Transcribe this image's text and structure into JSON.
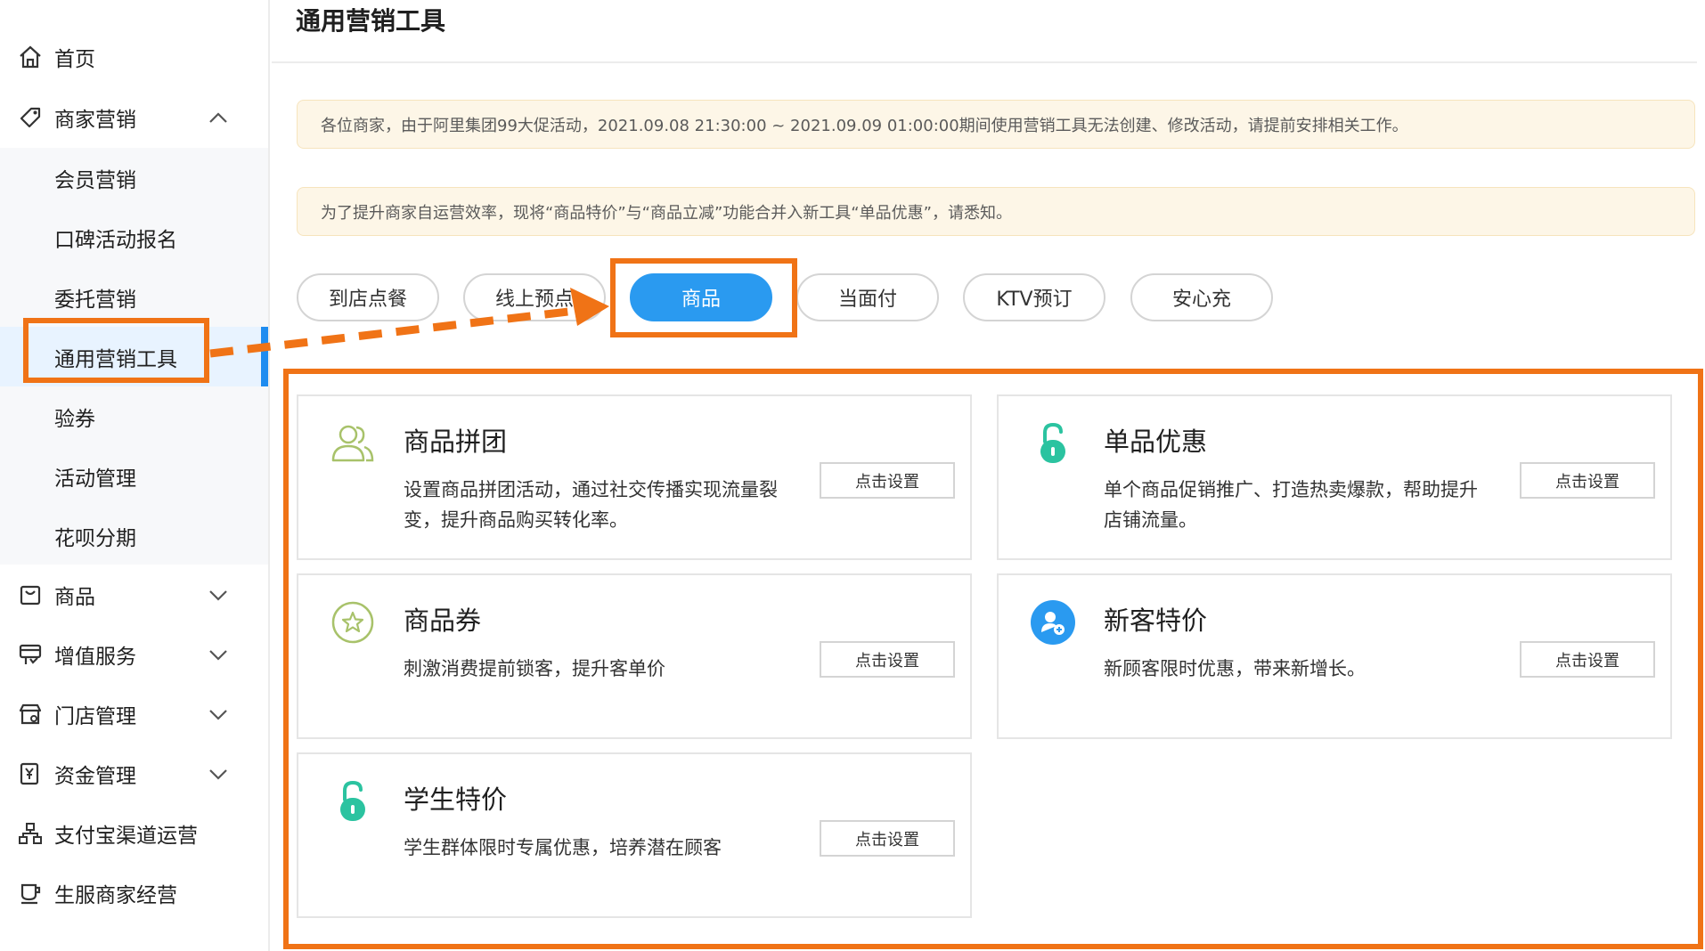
{
  "sidebar": {
    "items": [
      {
        "label": "首页",
        "icon": "home-icon"
      },
      {
        "label": "商家营销",
        "icon": "tag-icon",
        "expanded": true,
        "children": [
          "会员营销",
          "口碑活动报名",
          "委托营销",
          "通用营销工具",
          "验券",
          "活动管理",
          "花呗分期"
        ]
      },
      {
        "label": "商品",
        "icon": "bag-icon"
      },
      {
        "label": "增值服务",
        "icon": "value-service-icon"
      },
      {
        "label": "门店管理",
        "icon": "store-icon"
      },
      {
        "label": "资金管理",
        "icon": "funds-icon"
      },
      {
        "label": "支付宝渠道运营",
        "icon": "org-chart-icon"
      },
      {
        "label": "生服商家经营",
        "icon": "cup-icon"
      }
    ],
    "active_child": "通用营销工具"
  },
  "page": {
    "title": "通用营销工具",
    "notices": [
      "各位商家，由于阿里集团99大促活动，2021.09.08 21:30:00 ~ 2021.09.09 01:00:00期间使用营销工具无法创建、修改活动，请提前安排相关工作。",
      "为了提升商家自运营效率，现将“商品特价”与“商品立减”功能合并入新工具“单品优惠”，请悉知。"
    ]
  },
  "tabs": [
    {
      "label": "到店点餐",
      "active": false
    },
    {
      "label": "线上预点",
      "active": false
    },
    {
      "label": "商品",
      "active": true
    },
    {
      "label": "当面付",
      "active": false
    },
    {
      "label": "KTV预订",
      "active": false
    },
    {
      "label": "安心充",
      "active": false
    }
  ],
  "cards": [
    {
      "title": "商品拼团",
      "desc": "设置商品拼团活动，通过社交传播实现流量裂变，提升商品购买转化率。",
      "button": "点击设置",
      "icon": "group-users-icon"
    },
    {
      "title": "单品优惠",
      "desc": "单个商品促销推广、打造热卖爆款，帮助提升店铺流量。",
      "button": "点击设置",
      "icon": "unlock-icon"
    },
    {
      "title": "商品券",
      "desc": "刺激消费提前锁客，提升客单价",
      "button": "点击设置",
      "icon": "star-coupon-icon"
    },
    {
      "title": "新客特价",
      "desc": "新顾客限时优惠，带来新增长。",
      "button": "点击设置",
      "icon": "new-user-icon"
    },
    {
      "title": "学生特价",
      "desc": "学生群体限时专属优惠，培养潜在顾客",
      "button": "点击设置",
      "icon": "unlock-icon"
    }
  ],
  "colors": {
    "accent_blue": "#2a9af0",
    "annotation_orange": "#f07316",
    "notice_bg": "#fdf6e7",
    "icon_green": "#2bc3a0",
    "icon_olive": "#a8c26a"
  }
}
